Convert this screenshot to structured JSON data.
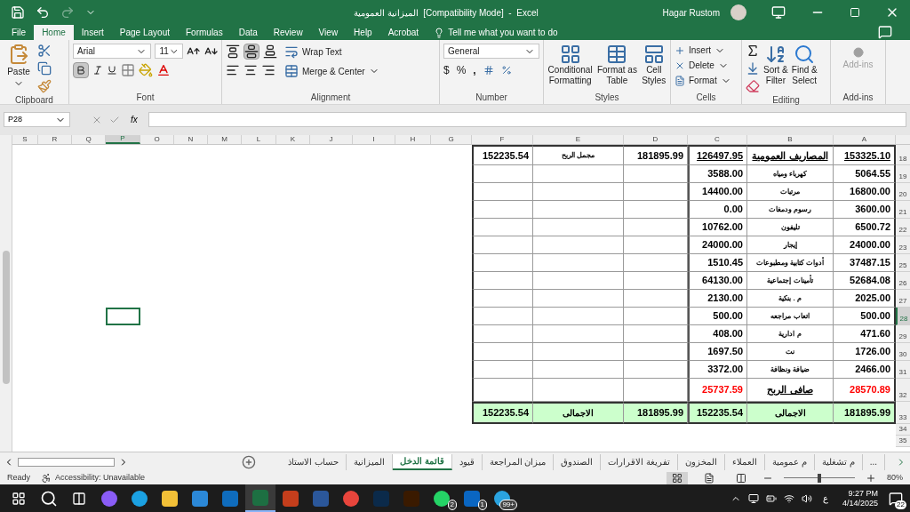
{
  "title_bar": {
    "title": "الميزانية العمومية  [Compatibility Mode]  -  Excel",
    "user": "Hagar Rustom"
  },
  "menu_tabs": [
    {
      "label": "File",
      "selected": false
    },
    {
      "label": "Home",
      "selected": true
    },
    {
      "label": "Insert",
      "selected": false
    },
    {
      "label": "Page Layout",
      "selected": false
    },
    {
      "label": "Formulas",
      "selected": false
    },
    {
      "label": "Data",
      "selected": false
    },
    {
      "label": "Review",
      "selected": false
    },
    {
      "label": "View",
      "selected": false
    },
    {
      "label": "Help",
      "selected": false
    },
    {
      "label": "Acrobat",
      "selected": false
    }
  ],
  "tell_me": "Tell me what you want to do",
  "ribbon": {
    "clipboard": {
      "paste": "Paste",
      "label": "Clipboard"
    },
    "font": {
      "name": "Arial",
      "size": "11",
      "bold": true,
      "label": "Font"
    },
    "alignment": {
      "middle_align": true,
      "wrap": "Wrap Text",
      "merge": "Merge & Center",
      "label": "Alignment"
    },
    "number": {
      "format": "General",
      "currency": "$",
      "percent": "%",
      "comma": ",",
      "label": "Number"
    },
    "styles": {
      "buttons": [
        {
          "kind": "conditional",
          "lines": [
            "Conditional",
            "Formatting"
          ]
        },
        {
          "kind": "table",
          "lines": [
            "Format as",
            "Table"
          ]
        },
        {
          "kind": "cell",
          "lines": [
            "Cell",
            "Styles"
          ]
        }
      ],
      "label": "Styles"
    },
    "cells": {
      "buttons": [
        {
          "kind": "insert",
          "label": "Insert"
        },
        {
          "kind": "delete",
          "label": "Delete"
        },
        {
          "kind": "format",
          "label": "Format"
        }
      ],
      "label": "Cells"
    },
    "editing": {
      "sort": [
        "Sort &",
        "Filter"
      ],
      "find": [
        "Find &",
        "Select"
      ],
      "label": "Editing"
    },
    "addins": {
      "button": "Add-ins",
      "disabled": true,
      "label": "Add-ins"
    }
  },
  "formula_bar": {
    "name_box": "P28",
    "fx": "fx"
  },
  "sheet": {
    "columns": [
      {
        "label": "S",
        "selected": false
      },
      {
        "label": "R",
        "selected": false
      },
      {
        "label": "Q",
        "selected": false
      },
      {
        "label": "P",
        "selected": true
      },
      {
        "label": "O",
        "selected": false
      },
      {
        "label": "N",
        "selected": false
      },
      {
        "label": "M",
        "selected": false
      },
      {
        "label": "L",
        "selected": false
      },
      {
        "label": "K",
        "selected": false
      },
      {
        "label": "J",
        "selected": false
      },
      {
        "label": "I",
        "selected": false
      },
      {
        "label": "H",
        "selected": false
      },
      {
        "label": "G",
        "selected": false
      },
      {
        "label": "F",
        "selected": false
      },
      {
        "label": "E",
        "selected": false
      },
      {
        "label": "D",
        "selected": false
      },
      {
        "label": "C",
        "selected": false
      },
      {
        "label": "B",
        "selected": false
      },
      {
        "label": "A",
        "selected": false
      }
    ],
    "rows": [
      {
        "number": "18",
        "kind": "header",
        "selected": false,
        "f": "152235.54",
        "e": "مجمل الربح",
        "d": "181895.99",
        "c": "126497.95",
        "b": "المصاريف العمومية",
        "a": "153325.10"
      },
      {
        "number": "19",
        "kind": "item",
        "selected": false,
        "c": "3588.00",
        "b": "كهرباء ومياه",
        "a": "5064.55"
      },
      {
        "number": "20",
        "kind": "item",
        "selected": false,
        "c": "14400.00",
        "b": "مرتبات",
        "a": "16800.00"
      },
      {
        "number": "21",
        "kind": "item",
        "selected": false,
        "c": "0.00",
        "b": "رسوم ودمغات",
        "a": "3600.00"
      },
      {
        "number": "22",
        "kind": "item",
        "selected": false,
        "c": "10762.00",
        "b": "تليفون",
        "a": "6500.72"
      },
      {
        "number": "23",
        "kind": "item",
        "selected": false,
        "c": "24000.00",
        "b": "إيجار",
        "a": "24000.00"
      },
      {
        "number": "25",
        "kind": "item",
        "selected": false,
        "c": "1510.45",
        "b": "أدوات كتابية ومطبوعات",
        "a": "37487.15"
      },
      {
        "number": "26",
        "kind": "item",
        "selected": false,
        "c": "64130.00",
        "b": "تأمينات إجتماعية",
        "a": "52684.08"
      },
      {
        "number": "27",
        "kind": "item",
        "selected": false,
        "c": "2130.00",
        "b": "م . بنكية",
        "a": "2025.00"
      },
      {
        "number": "28",
        "kind": "item",
        "selected": true,
        "c": "500.00",
        "b": "اتعاب مراجعه",
        "a": "500.00"
      },
      {
        "number": "29",
        "kind": "item",
        "selected": false,
        "c": "408.00",
        "b": "م ادارية",
        "a": "471.60"
      },
      {
        "number": "30",
        "kind": "item",
        "selected": false,
        "c": "1697.50",
        "b": "نت",
        "a": "1726.00"
      },
      {
        "number": "31",
        "kind": "item",
        "selected": false,
        "c": "3372.00",
        "b": "ضيافة ونظافة",
        "a": "2466.00"
      },
      {
        "number": "32",
        "kind": "net",
        "selected": false,
        "c": "25737.59",
        "b": "صافى الربح",
        "a": "28570.89"
      },
      {
        "number": "33",
        "kind": "total",
        "selected": false,
        "f": "152235.54",
        "e": "الاجمالى",
        "d": "181895.99",
        "c": "152235.54",
        "b": "الاجمالى",
        "a": "181895.99"
      },
      {
        "number": "34",
        "kind": "blank",
        "selected": false
      },
      {
        "number": "35",
        "kind": "blank",
        "selected": false
      }
    ]
  },
  "sheet_tabs": [
    {
      "label": "...",
      "selected": false
    },
    {
      "label": "م تشغلية",
      "selected": false
    },
    {
      "label": "م عمومية",
      "selected": false
    },
    {
      "label": "العملاء",
      "selected": false
    },
    {
      "label": "المخزون",
      "selected": false
    },
    {
      "label": "تفريغة الاقرارات",
      "selected": false
    },
    {
      "label": "الصندوق",
      "selected": false
    },
    {
      "label": "ميزان المراجعة",
      "selected": false
    },
    {
      "label": "قيود",
      "selected": false
    },
    {
      "label": "قائمة الدخل",
      "selected": true
    },
    {
      "label": "الميزانية",
      "selected": false
    },
    {
      "label": "حساب الاستاذ",
      "selected": false
    }
  ],
  "status_bar": {
    "ready": "Ready",
    "accessibility": "Accessibility: Unavailable",
    "views": [
      {
        "kind": "normal",
        "selected": true
      },
      {
        "kind": "page_layout",
        "selected": false
      },
      {
        "kind": "page_break",
        "selected": false
      }
    ],
    "zoom": {
      "reading": "80%",
      "level": 0.5
    }
  },
  "taskbar": {
    "apps": [
      {
        "kind": "copilot",
        "selected": false
      },
      {
        "kind": "edge",
        "selected": false
      },
      {
        "kind": "folder",
        "selected": false
      },
      {
        "kind": "store",
        "selected": false
      },
      {
        "kind": "outlook",
        "selected": false
      },
      {
        "kind": "excel",
        "selected": true
      },
      {
        "kind": "powerpoint",
        "selected": false
      },
      {
        "kind": "word",
        "selected": false
      },
      {
        "kind": "chrome",
        "selected": false
      },
      {
        "kind": "photoshop",
        "selected": false
      },
      {
        "kind": "illustrator",
        "selected": false
      },
      {
        "kind": "chat",
        "selected": false,
        "badge": "2"
      },
      {
        "kind": "linkedin",
        "selected": false,
        "badge": "1"
      },
      {
        "kind": "telegram",
        "selected": false,
        "badge": "99+"
      }
    ],
    "language": "ع",
    "time": "9:27 PM",
    "date": "4/14/2025",
    "notifications": "22"
  }
}
